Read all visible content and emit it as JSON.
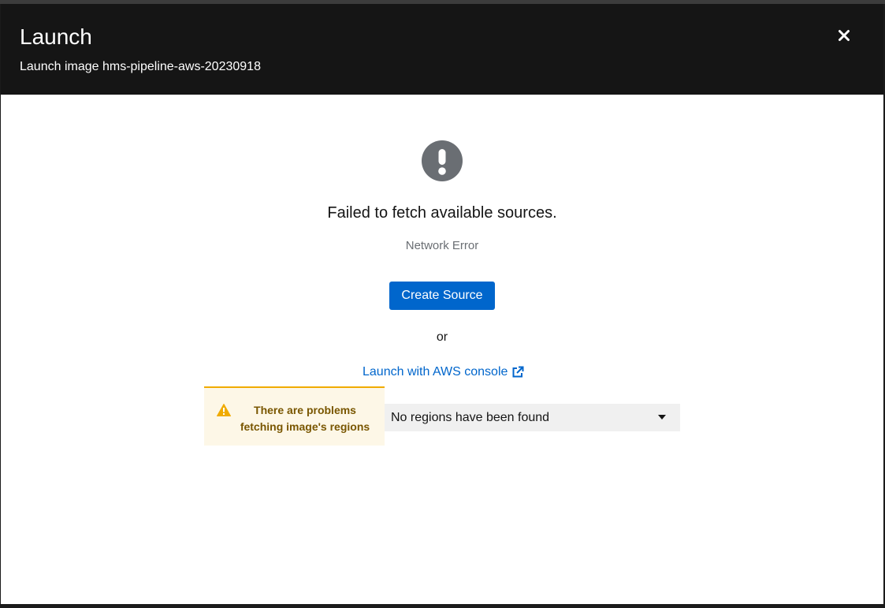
{
  "modal": {
    "title": "Launch",
    "subtitle": "Launch image hms-pipeline-aws-20230918",
    "close_icon": "close-icon"
  },
  "empty_state": {
    "icon": "exclamation-circle-icon",
    "title": "Failed to fetch available sources.",
    "body": "Network Error",
    "create_button_label": "Create Source",
    "or_text": "or",
    "aws_link_label": "Launch with AWS console",
    "aws_link_icon": "external-link-icon"
  },
  "regions": {
    "warning_icon": "warning-triangle-icon",
    "warning_text": "There are problems fetching image's regions",
    "select_value": "No regions have been found",
    "select_icon": "caret-down-icon"
  },
  "colors": {
    "header_bg": "#151515",
    "primary": "#0066cc",
    "warning": "#f0ab00",
    "warning_bg": "#fdf7e7",
    "icon_gray": "#6a6e73"
  }
}
